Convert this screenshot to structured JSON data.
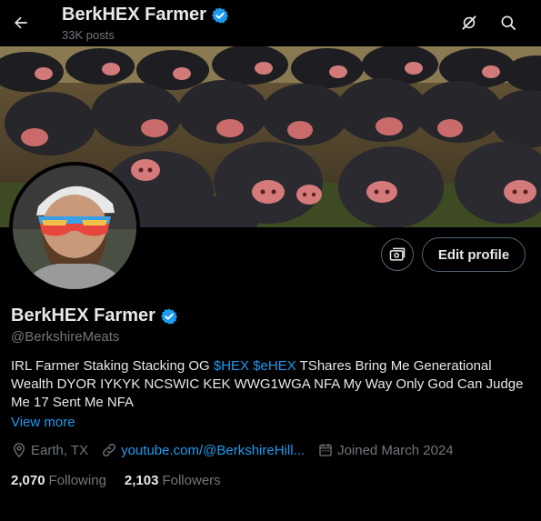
{
  "header": {
    "title": "BerkHEX Farmer",
    "posts": "33K posts"
  },
  "profile": {
    "display_name": "BerkHEX Farmer",
    "handle": "@BerkshireMeats",
    "edit_label": "Edit profile",
    "bio_part1": "IRL Farmer Staking Stacking OG ",
    "bio_tag1": "$HEX",
    "bio_space": " ",
    "bio_tag2": "$eHEX",
    "bio_part2": " TShares Bring Me Generational Wealth DYOR IYKYK NCSWIC KEK WWG1WGA NFA My Way Only God Can Judge Me 17 Sent Me NFA",
    "view_more": "View more",
    "location": "Earth, TX",
    "website": "youtube.com/@BerkshireHill...",
    "joined": "Joined March 2024",
    "following_count": "2,070",
    "following_label": "Following",
    "followers_count": "2,103",
    "followers_label": "Followers"
  },
  "icons": {
    "back": "arrow-left-icon",
    "grok": "grok-icon",
    "search": "search-icon",
    "verified": "verified-badge-icon",
    "money": "money-icon",
    "location": "location-icon",
    "link": "link-icon",
    "calendar": "calendar-icon"
  },
  "colors": {
    "accent": "#1d9bf0",
    "background": "#000000",
    "text": "#e7e9ea",
    "muted": "#71767b"
  }
}
